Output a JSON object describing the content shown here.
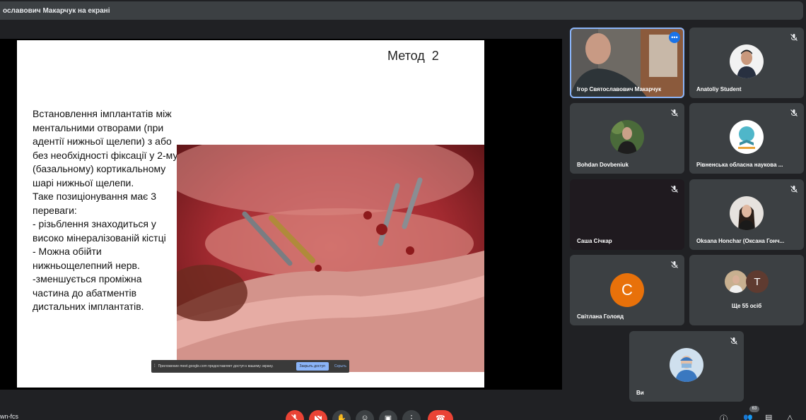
{
  "banner": {
    "text": "ославович Макарчук на екрані"
  },
  "slide": {
    "title": "Метод  2",
    "body_lines": [
      "Встановлення імплантатів між ментальними отворами (при адентії нижньої щелепи) з або без необхідності фіксації у 2-му (базальному) кортикальному шарі нижньої щелепи.",
      "Таке позиціонування має 3 переваги:",
      "- різьблення знаходиться у високо мінералізованій кістці",
      "- Можна обійти нижньощелепний нерв.",
      "-зменшується проміжна частина до абатментів дистальних імплантатів."
    ]
  },
  "share_bar": {
    "text": "Приложение meet.google.com предоставляет доступ к вашему экрану.",
    "stop_label": "Закрыть доступ",
    "hide_label": "Скрыть"
  },
  "participants": [
    {
      "name": "Ігор Святославович Макарчук",
      "type": "video",
      "active": true
    },
    {
      "name": "Anatoliy Student",
      "type": "photo"
    },
    {
      "name": "Bohdan Dovbeniuk",
      "type": "photo"
    },
    {
      "name": "Рівненська обласна наукова ...",
      "type": "logo"
    },
    {
      "name": "Саша Січкар",
      "type": "dark"
    },
    {
      "name": "Oksana Honchar (Оксана Гонч...",
      "type": "photo"
    },
    {
      "name": "Світлана Голояд",
      "type": "letter",
      "letter": "С",
      "color": "#e8710a"
    },
    {
      "name": "Ще 55 осіб",
      "type": "more",
      "letter": "Т"
    },
    {
      "name": "Ви",
      "type": "photo"
    }
  ],
  "bottom": {
    "meeting_code": "wn-fcs",
    "participant_count": "63"
  },
  "icons": {
    "mic_off": "mic-off-icon",
    "cam_off": "camera-off-icon",
    "hand": "raise-hand-icon",
    "emoji": "emoji-icon",
    "present": "present-icon",
    "more": "more-vert-icon",
    "hangup": "hangup-icon",
    "info": "info-icon",
    "people": "people-icon",
    "chat": "chat-icon",
    "activities": "activities-icon"
  },
  "colors": {
    "accent": "#8ab4f8",
    "danger": "#ea4335",
    "tile": "#3c4043",
    "background": "#202124"
  }
}
